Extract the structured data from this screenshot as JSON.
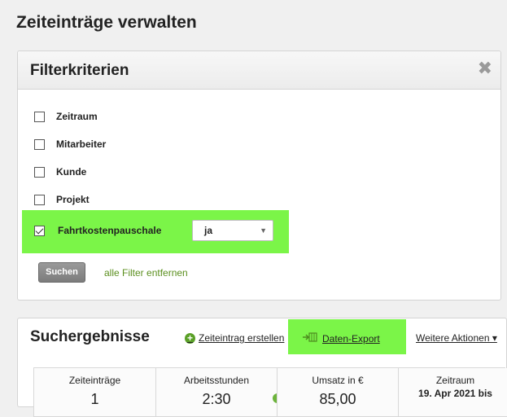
{
  "page": {
    "title": "Zeiteinträge verwalten"
  },
  "filter": {
    "title": "Filterkriterien",
    "close_icon": "close-x-icon",
    "items": [
      {
        "label": "Zeitraum",
        "checked": false
      },
      {
        "label": "Mitarbeiter",
        "checked": false
      },
      {
        "label": "Kunde",
        "checked": false
      },
      {
        "label": "Projekt",
        "checked": false
      },
      {
        "label": "Fahrtkostenpauschale",
        "checked": true
      }
    ],
    "fahrt_select": {
      "value": "ja"
    },
    "search_button": "Suchen",
    "remove_link": "alle Filter entfernen",
    "highlight_color": "#7bf548"
  },
  "results": {
    "title": "Suchergebnisse",
    "actions": {
      "create": "Zeiteintrag erstellen",
      "export": "Daten-Export",
      "more": "Weitere Aktionen ▾"
    },
    "stats": [
      {
        "label": "Zeiteinträge",
        "value": "1"
      },
      {
        "label": "Arbeitsstunden",
        "value": "2:30"
      },
      {
        "label": "Umsatz in €",
        "value": "85,00"
      },
      {
        "label": "Zeitraum",
        "value": "19. Apr 2021 bis"
      }
    ]
  }
}
